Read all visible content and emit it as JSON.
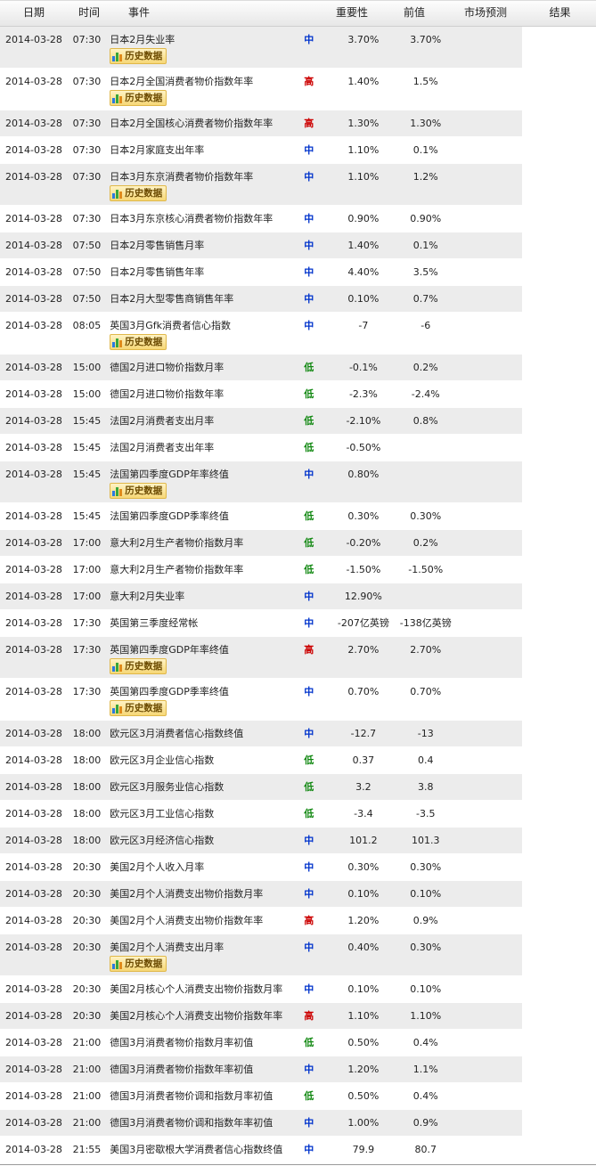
{
  "columns": {
    "date": "日期",
    "time": "时间",
    "event": "事件",
    "importance": "重要性",
    "previous": "前值",
    "forecast": "市场预测",
    "result": "结果"
  },
  "history_label": "历史数据",
  "colors": {
    "high": "#cc0000",
    "mid": "#0033cc",
    "low": "#118811",
    "row_alt": "#ececec"
  },
  "rows": [
    {
      "date": "2014-03-28",
      "time": "07:30",
      "event": "日本2月失业率",
      "imp": "中",
      "level": "mid",
      "prev": "3.70%",
      "fore": "3.70%",
      "result": "",
      "history": true
    },
    {
      "date": "2014-03-28",
      "time": "07:30",
      "event": "日本2月全国消费者物价指数年率",
      "imp": "高",
      "level": "high",
      "prev": "1.40%",
      "fore": "1.5%",
      "result": "",
      "history": true
    },
    {
      "date": "2014-03-28",
      "time": "07:30",
      "event": "日本2月全国核心消费者物价指数年率",
      "imp": "高",
      "level": "high",
      "prev": "1.30%",
      "fore": "1.30%",
      "result": "",
      "history": false
    },
    {
      "date": "2014-03-28",
      "time": "07:30",
      "event": "日本2月家庭支出年率",
      "imp": "中",
      "level": "mid",
      "prev": "1.10%",
      "fore": "0.1%",
      "result": "",
      "history": false
    },
    {
      "date": "2014-03-28",
      "time": "07:30",
      "event": "日本3月东京消费者物价指数年率",
      "imp": "中",
      "level": "mid",
      "prev": "1.10%",
      "fore": "1.2%",
      "result": "",
      "history": true
    },
    {
      "date": "2014-03-28",
      "time": "07:30",
      "event": "日本3月东京核心消费者物价指数年率",
      "imp": "中",
      "level": "mid",
      "prev": "0.90%",
      "fore": "0.90%",
      "result": "",
      "history": false
    },
    {
      "date": "2014-03-28",
      "time": "07:50",
      "event": "日本2月零售销售月率",
      "imp": "中",
      "level": "mid",
      "prev": "1.40%",
      "fore": "0.1%",
      "result": "",
      "history": false
    },
    {
      "date": "2014-03-28",
      "time": "07:50",
      "event": "日本2月零售销售年率",
      "imp": "中",
      "level": "mid",
      "prev": "4.40%",
      "fore": "3.5%",
      "result": "",
      "history": false
    },
    {
      "date": "2014-03-28",
      "time": "07:50",
      "event": "日本2月大型零售商销售年率",
      "imp": "中",
      "level": "mid",
      "prev": "0.10%",
      "fore": "0.7%",
      "result": "",
      "history": false
    },
    {
      "date": "2014-03-28",
      "time": "08:05",
      "event": "英国3月Gfk消费者信心指数",
      "imp": "中",
      "level": "mid",
      "prev": "-7",
      "fore": "-6",
      "result": "",
      "history": true
    },
    {
      "date": "2014-03-28",
      "time": "15:00",
      "event": "德国2月进口物价指数月率",
      "imp": "低",
      "level": "low",
      "prev": "-0.1%",
      "fore": "0.2%",
      "result": "",
      "history": false
    },
    {
      "date": "2014-03-28",
      "time": "15:00",
      "event": "德国2月进口物价指数年率",
      "imp": "低",
      "level": "low",
      "prev": "-2.3%",
      "fore": "-2.4%",
      "result": "",
      "history": false
    },
    {
      "date": "2014-03-28",
      "time": "15:45",
      "event": "法国2月消费者支出月率",
      "imp": "低",
      "level": "low",
      "prev": "-2.10%",
      "fore": "0.8%",
      "result": "",
      "history": false
    },
    {
      "date": "2014-03-28",
      "time": "15:45",
      "event": "法国2月消费者支出年率",
      "imp": "低",
      "level": "low",
      "prev": "-0.50%",
      "fore": "",
      "result": "",
      "history": false
    },
    {
      "date": "2014-03-28",
      "time": "15:45",
      "event": "法国第四季度GDP年率终值",
      "imp": "中",
      "level": "mid",
      "prev": "0.80%",
      "fore": "",
      "result": "",
      "history": true
    },
    {
      "date": "2014-03-28",
      "time": "15:45",
      "event": "法国第四季度GDP季率终值",
      "imp": "低",
      "level": "low",
      "prev": "0.30%",
      "fore": "0.30%",
      "result": "",
      "history": false
    },
    {
      "date": "2014-03-28",
      "time": "17:00",
      "event": "意大利2月生产者物价指数月率",
      "imp": "低",
      "level": "low",
      "prev": "-0.20%",
      "fore": "0.2%",
      "result": "",
      "history": false
    },
    {
      "date": "2014-03-28",
      "time": "17:00",
      "event": "意大利2月生产者物价指数年率",
      "imp": "低",
      "level": "low",
      "prev": "-1.50%",
      "fore": "-1.50%",
      "result": "",
      "history": false
    },
    {
      "date": "2014-03-28",
      "time": "17:00",
      "event": "意大利2月失业率",
      "imp": "中",
      "level": "mid",
      "prev": "12.90%",
      "fore": "",
      "result": "",
      "history": false
    },
    {
      "date": "2014-03-28",
      "time": "17:30",
      "event": "英国第三季度经常帐",
      "imp": "中",
      "level": "mid",
      "prev": "-207亿英镑",
      "fore": "-138亿英镑",
      "result": "",
      "history": false
    },
    {
      "date": "2014-03-28",
      "time": "17:30",
      "event": "英国第四季度GDP年率终值",
      "imp": "高",
      "level": "high",
      "prev": "2.70%",
      "fore": "2.70%",
      "result": "",
      "history": true
    },
    {
      "date": "2014-03-28",
      "time": "17:30",
      "event": "英国第四季度GDP季率终值",
      "imp": "中",
      "level": "mid",
      "prev": "0.70%",
      "fore": "0.70%",
      "result": "",
      "history": true
    },
    {
      "date": "2014-03-28",
      "time": "18:00",
      "event": "欧元区3月消费者信心指数终值",
      "imp": "中",
      "level": "mid",
      "prev": "-12.7",
      "fore": "-13",
      "result": "",
      "history": false
    },
    {
      "date": "2014-03-28",
      "time": "18:00",
      "event": "欧元区3月企业信心指数",
      "imp": "低",
      "level": "low",
      "prev": "0.37",
      "fore": "0.4",
      "result": "",
      "history": false
    },
    {
      "date": "2014-03-28",
      "time": "18:00",
      "event": "欧元区3月服务业信心指数",
      "imp": "低",
      "level": "low",
      "prev": "3.2",
      "fore": "3.8",
      "result": "",
      "history": false
    },
    {
      "date": "2014-03-28",
      "time": "18:00",
      "event": "欧元区3月工业信心指数",
      "imp": "低",
      "level": "low",
      "prev": "-3.4",
      "fore": "-3.5",
      "result": "",
      "history": false
    },
    {
      "date": "2014-03-28",
      "time": "18:00",
      "event": "欧元区3月经济信心指数",
      "imp": "中",
      "level": "mid",
      "prev": "101.2",
      "fore": "101.3",
      "result": "",
      "history": false
    },
    {
      "date": "2014-03-28",
      "time": "20:30",
      "event": "美国2月个人收入月率",
      "imp": "中",
      "level": "mid",
      "prev": "0.30%",
      "fore": "0.30%",
      "result": "",
      "history": false
    },
    {
      "date": "2014-03-28",
      "time": "20:30",
      "event": "美国2月个人消费支出物价指数月率",
      "imp": "中",
      "level": "mid",
      "prev": "0.10%",
      "fore": "0.10%",
      "result": "",
      "history": false
    },
    {
      "date": "2014-03-28",
      "time": "20:30",
      "event": "美国2月个人消费支出物价指数年率",
      "imp": "高",
      "level": "high",
      "prev": "1.20%",
      "fore": "0.9%",
      "result": "",
      "history": false
    },
    {
      "date": "2014-03-28",
      "time": "20:30",
      "event": "美国2月个人消费支出月率",
      "imp": "中",
      "level": "mid",
      "prev": "0.40%",
      "fore": "0.30%",
      "result": "",
      "history": true
    },
    {
      "date": "2014-03-28",
      "time": "20:30",
      "event": "美国2月核心个人消费支出物价指数月率",
      "imp": "中",
      "level": "mid",
      "prev": "0.10%",
      "fore": "0.10%",
      "result": "",
      "history": false
    },
    {
      "date": "2014-03-28",
      "time": "20:30",
      "event": "美国2月核心个人消费支出物价指数年率",
      "imp": "高",
      "level": "high",
      "prev": "1.10%",
      "fore": "1.10%",
      "result": "",
      "history": false
    },
    {
      "date": "2014-03-28",
      "time": "21:00",
      "event": "德国3月消费者物价指数月率初值",
      "imp": "低",
      "level": "low",
      "prev": "0.50%",
      "fore": "0.4%",
      "result": "",
      "history": false
    },
    {
      "date": "2014-03-28",
      "time": "21:00",
      "event": "德国3月消费者物价指数年率初值",
      "imp": "中",
      "level": "mid",
      "prev": "1.20%",
      "fore": "1.1%",
      "result": "",
      "history": false
    },
    {
      "date": "2014-03-28",
      "time": "21:00",
      "event": "德国3月消费者物价调和指数月率初值",
      "imp": "低",
      "level": "low",
      "prev": "0.50%",
      "fore": "0.4%",
      "result": "",
      "history": false
    },
    {
      "date": "2014-03-28",
      "time": "21:00",
      "event": "德国3月消费者物价调和指数年率初值",
      "imp": "中",
      "level": "mid",
      "prev": "1.00%",
      "fore": "0.9%",
      "result": "",
      "history": false
    },
    {
      "date": "2014-03-28",
      "time": "21:55",
      "event": "美国3月密歇根大学消费者信心指数终值",
      "imp": "中",
      "level": "mid",
      "prev": "79.9",
      "fore": "80.7",
      "result": "",
      "history": false
    }
  ]
}
